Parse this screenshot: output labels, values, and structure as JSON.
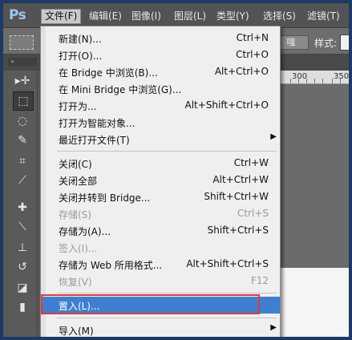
{
  "app": {
    "logo": "Ps"
  },
  "menubar": {
    "items": [
      {
        "label": "文件(F)"
      },
      {
        "label": "编辑(E)"
      },
      {
        "label": "图像(I)"
      },
      {
        "label": "图层(L)"
      },
      {
        "label": "类型(Y)"
      },
      {
        "label": "选择(S)"
      },
      {
        "label": "滤镜(T)"
      }
    ]
  },
  "options_bar": {
    "button_label": "调整边缘",
    "button_label_visible": "嗤",
    "style_label": "样式:"
  },
  "ruler": {
    "ticks": [
      "300",
      "350"
    ]
  },
  "file_menu": {
    "items": [
      {
        "label": "新建(N)...",
        "shortcut": "Ctrl+N"
      },
      {
        "label": "打开(O)...",
        "shortcut": "Ctrl+O"
      },
      {
        "label": "在 Bridge 中浏览(B)...",
        "shortcut": "Alt+Ctrl+O"
      },
      {
        "label": "在 Mini Bridge 中浏览(G)...",
        "shortcut": ""
      },
      {
        "label": "打开为...",
        "shortcut": "Alt+Shift+Ctrl+O"
      },
      {
        "label": "打开为智能对象...",
        "shortcut": ""
      },
      {
        "label": "最近打开文件(T)",
        "shortcut": "",
        "submenu": "▶"
      },
      {
        "label": "关闭(C)",
        "shortcut": "Ctrl+W"
      },
      {
        "label": "关闭全部",
        "shortcut": "Alt+Ctrl+W"
      },
      {
        "label": "关闭并转到 Bridge...",
        "shortcut": "Shift+Ctrl+W"
      },
      {
        "label": "存储(S)",
        "shortcut": "Ctrl+S"
      },
      {
        "label": "存储为(A)...",
        "shortcut": "Shift+Ctrl+S"
      },
      {
        "label": "签入(I)...",
        "shortcut": ""
      },
      {
        "label": "存储为 Web 所用格式...",
        "shortcut": "Alt+Shift+Ctrl+S"
      },
      {
        "label": "恢复(V)",
        "shortcut": "F12"
      },
      {
        "label": "置入(L)...",
        "shortcut": ""
      },
      {
        "label": "导入(M)",
        "shortcut": "",
        "submenu": "▶"
      }
    ]
  },
  "icons": {
    "tools": [
      "move-icon",
      "marquee-icon",
      "lasso-icon",
      "quick-select-icon",
      "crop-icon",
      "eyedropper-icon",
      "healing-icon",
      "brush-icon",
      "stamp-icon",
      "history-brush-icon",
      "eraser-icon",
      "gradient-icon"
    ]
  },
  "colors": {
    "highlight": "#3d7fd1",
    "annotation_box": "#e53935",
    "menubar": "#535353"
  }
}
